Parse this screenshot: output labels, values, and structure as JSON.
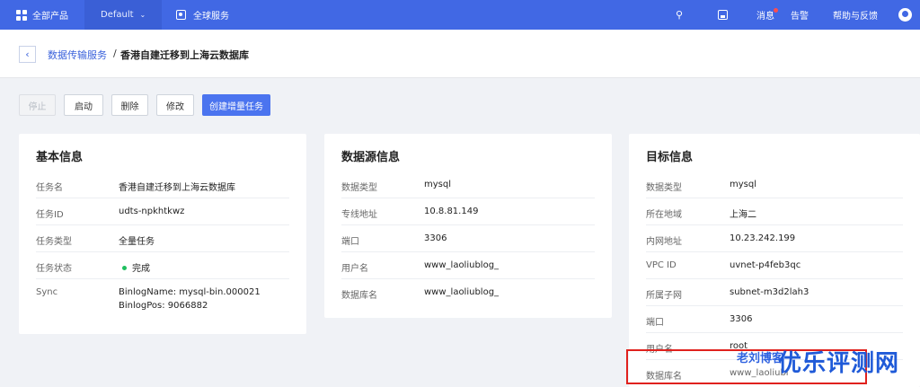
{
  "topbar": {
    "products": "全部产品",
    "project": "Default",
    "global": "全球服务",
    "messages": "消息",
    "alarm": "告警",
    "help": "帮助与反馈"
  },
  "breadcrumb": {
    "parent": "数据传输服务",
    "separator": "/",
    "current": "香港自建迁移到上海云数据库"
  },
  "actions": {
    "stop": "停止",
    "start": "启动",
    "delete": "删除",
    "edit": "修改",
    "create_incremental": "创建增量任务"
  },
  "basic": {
    "title": "基本信息",
    "rows": [
      {
        "label": "任务名",
        "value": "香港自建迁移到上海云数据库"
      },
      {
        "label": "任务ID",
        "value": "udts-npkhtkwz"
      },
      {
        "label": "任务类型",
        "value": "全量任务"
      },
      {
        "label": "任务状态",
        "value": "完成"
      },
      {
        "label": "Sync",
        "value": "BinlogName: mysql-bin.000021",
        "value2": "BinlogPos: 9066882"
      }
    ]
  },
  "source": {
    "title": "数据源信息",
    "rows": [
      {
        "label": "数据类型",
        "value": "mysql"
      },
      {
        "label": "专线地址",
        "value": "10.8.81.149"
      },
      {
        "label": "端口",
        "value": "3306"
      },
      {
        "label": "用户名",
        "value": "www_laoliublog_"
      },
      {
        "label": "数据库名",
        "value": "www_laoliublog_"
      }
    ]
  },
  "target": {
    "title": "目标信息",
    "rows": [
      {
        "label": "数据类型",
        "value": "mysql"
      },
      {
        "label": "所在地域",
        "value": "上海二"
      },
      {
        "label": "内网地址",
        "value": "10.23.242.199"
      },
      {
        "label": "VPC ID",
        "value": "uvnet-p4feb3qc"
      },
      {
        "label": "所属子网",
        "value": "subnet-m3d2lah3"
      },
      {
        "label": "端口",
        "value": "3306"
      },
      {
        "label": "用户名",
        "value": "root"
      },
      {
        "label": "数据库名",
        "value": "www_laoliubl"
      }
    ]
  },
  "watermark": {
    "small": "老刘博客",
    "big": "优乐评测网"
  },
  "colors": {
    "topbar": "#4168e4",
    "primary": "#4b74ef",
    "status_done": "#1fbf5f",
    "highlight": "#e0211d"
  },
  "icons": {
    "products": "grid-icon",
    "project": "chevron-down-icon",
    "global": "global-service-icon",
    "search": "search-icon",
    "image": "image-icon",
    "avatar": "user-avatar-icon",
    "back": "chevron-left-icon"
  }
}
